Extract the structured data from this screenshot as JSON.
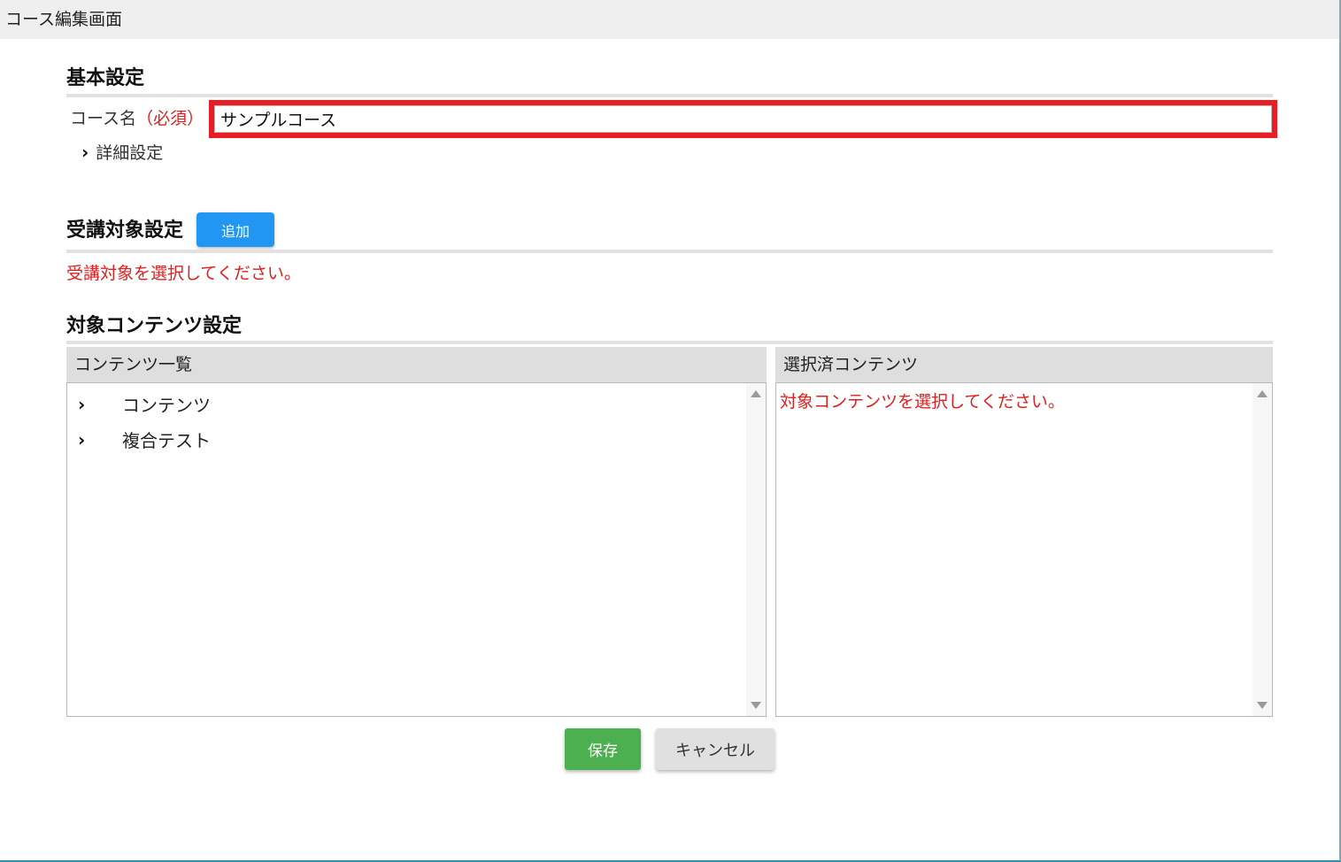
{
  "window": {
    "title": "コース編集画面"
  },
  "basic": {
    "heading": "基本設定",
    "course_name_label": "コース名",
    "required_label": "（必須）",
    "course_name_value": "サンプルコース",
    "detail_toggle_label": "詳細設定"
  },
  "audience": {
    "heading": "受講対象設定",
    "add_label": "追加",
    "error": "受講対象を選択してください。"
  },
  "contents": {
    "heading": "対象コンテンツ設定",
    "list_header": "コンテンツ一覧",
    "items": [
      {
        "label": "コンテンツ"
      },
      {
        "label": "複合テスト"
      }
    ],
    "selected_header": "選択済コンテンツ",
    "selected_error": "対象コンテンツを選択してください。"
  },
  "actions": {
    "save_label": "保存",
    "cancel_label": "キャンセル"
  },
  "colors": {
    "highlight": "#ec1c24",
    "primary": "#2196f3",
    "success": "#4caf50",
    "error": "#e02020"
  },
  "icons": {
    "expand": "chevron-right-icon",
    "scroll_up": "scroll-up-arrow-icon",
    "scroll_down": "scroll-down-arrow-icon"
  }
}
